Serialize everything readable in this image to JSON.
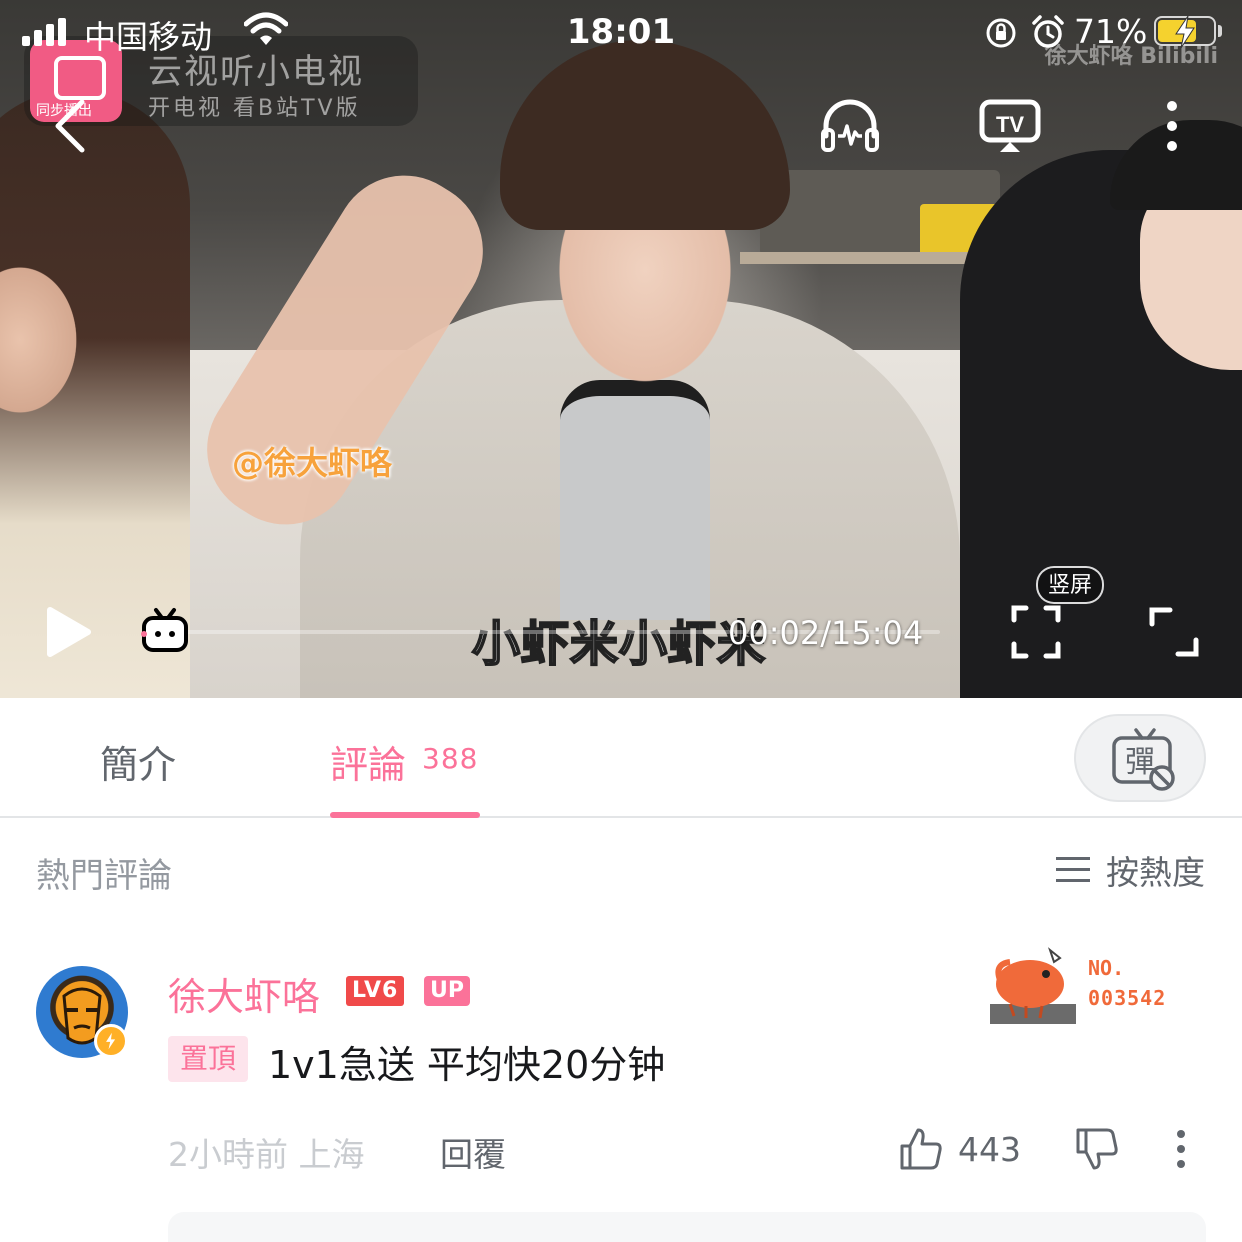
{
  "status_bar": {
    "carrier": "中国移动",
    "time": "18:01",
    "battery_percent": "71%",
    "battery_level": 0.71,
    "icons": [
      "signal-icon",
      "wifi-icon",
      "orientation-lock-icon",
      "alarm-icon",
      "battery-icon",
      "charging-bolt-icon"
    ]
  },
  "video": {
    "ad_title": "云视听小电视",
    "ad_subtitle": "开电视 看B站TV版",
    "ad_tag": "同步播出",
    "watermark": "徐大虾咯 Bilibili",
    "floating_danmaku": "@徐大虾咯",
    "subtitle": "小虾米小虾米",
    "time_readout": "00:02/15:04",
    "progress": 0.0022,
    "vertical_label": "竖屏",
    "icons": [
      "back-icon",
      "headphones-icon",
      "cast-tv-icon",
      "more-vertical-icon",
      "play-icon",
      "tv-mascot-icon",
      "vertical-screen-icon",
      "fullscreen-icon"
    ]
  },
  "tabs": {
    "intro_label": "簡介",
    "comments_label": "評論",
    "comments_count": "388",
    "active": "comments",
    "danmaku_button_glyph": "彈",
    "accent": "#fb7299"
  },
  "comments": {
    "section_label": "熱門評論",
    "sort_label": "按熱度",
    "items": [
      {
        "username": "徐大虾咯",
        "level_badge": "LV6",
        "up_badge": "UP",
        "pin_badge": "置頂",
        "text": "1v1急送 平均快20分钟",
        "fan_no_label": "NO.",
        "fan_no_value": "003542",
        "time_location": "2小時前 上海",
        "reply_label": "回覆",
        "like_count": "443"
      }
    ]
  }
}
